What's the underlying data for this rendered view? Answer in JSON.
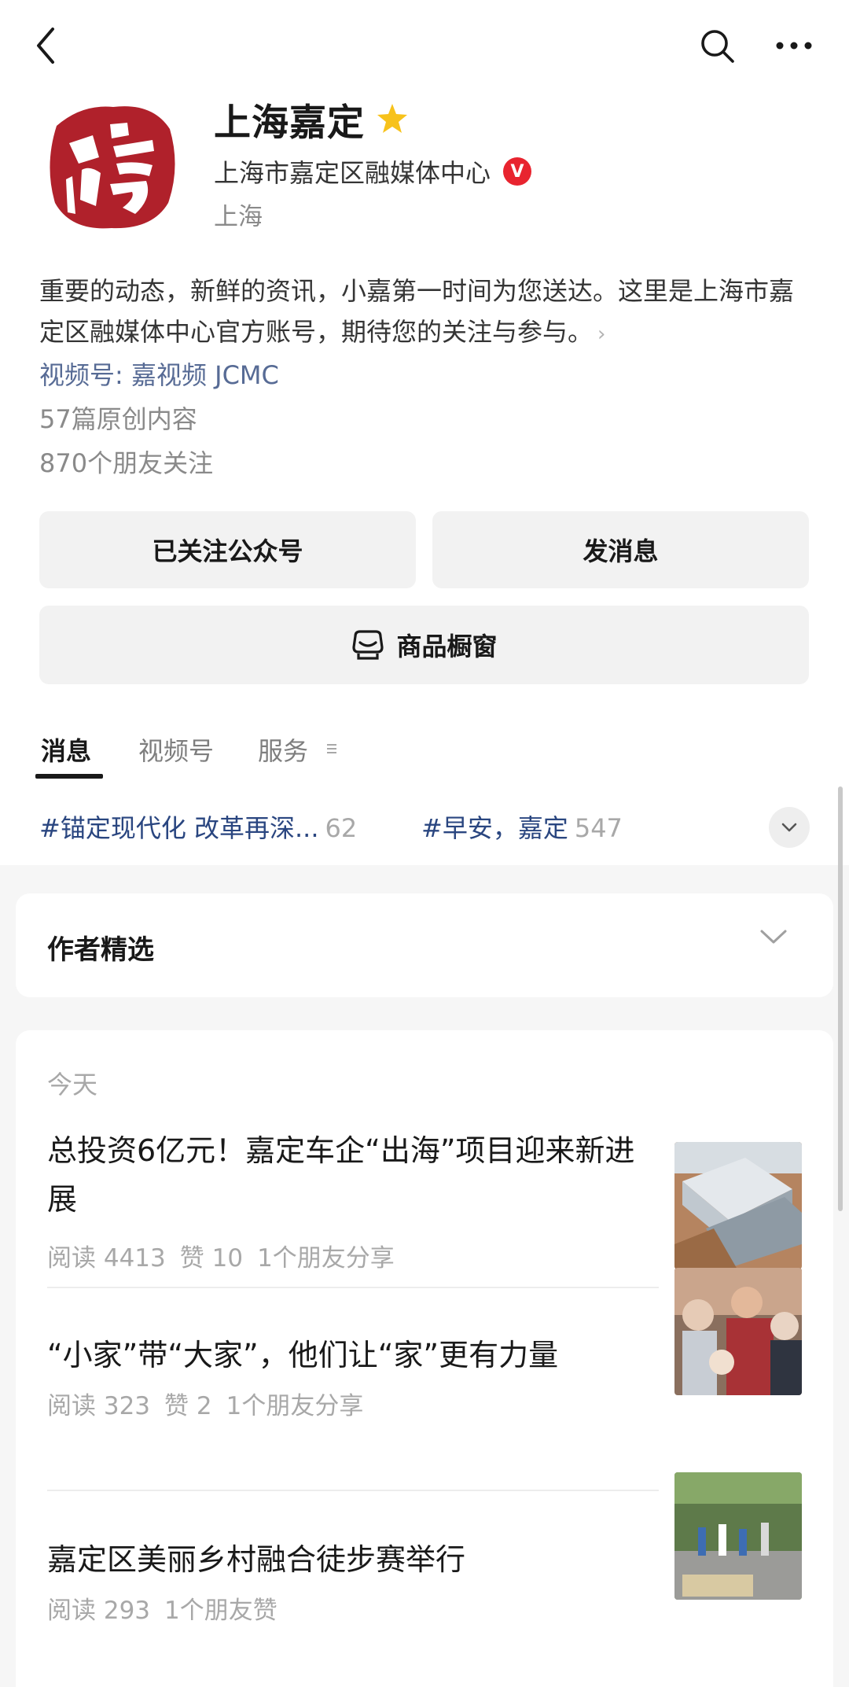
{
  "header": {
    "back_icon": "chevron-left-icon",
    "search_icon": "search-icon",
    "more_icon": "more-dots-icon"
  },
  "profile": {
    "name": "上海嘉定",
    "star_color": "#f7c21b",
    "organization": "上海市嘉定区融媒体中心",
    "verified_badge": "V",
    "verified_color": "#e8242f",
    "region": "上海",
    "description": "重要的动态，新鲜的资讯，小嘉第一时间为您送达。这里是上海市嘉定区融媒体中心官方账号，期待您的关注与参与。",
    "channel": "视频号: 嘉视频 JCMC",
    "original_count": "57篇原创内容",
    "friends_following": "870个朋友关注"
  },
  "actions": {
    "follow_label": "已关注公众号",
    "message_label": "发消息",
    "shop_label": "商品橱窗"
  },
  "tabs": [
    {
      "label": "消息",
      "active": true
    },
    {
      "label": "视频号",
      "active": false
    },
    {
      "label": "服务",
      "active": false
    }
  ],
  "topics": [
    {
      "label": "#锚定现代化 改革再深...",
      "count": "62"
    },
    {
      "label": "#早安，嘉定",
      "count": "547"
    }
  ],
  "author_picks": {
    "title": "作者精选"
  },
  "feed": {
    "day_label": "今天",
    "articles": [
      {
        "title": "总投资6亿元！嘉定车企“出海”项目迎来新进展",
        "meta": [
          "阅读 4413",
          "赞 10",
          "1个朋友分享"
        ]
      },
      {
        "title": "“小家”带“大家”，他们让“家”更有力量",
        "meta": [
          "阅读 323",
          "赞 2",
          "1个朋友分享"
        ]
      },
      {
        "title": "嘉定区美丽乡村融合徒步赛举行",
        "meta": [
          "阅读 293",
          "1个朋友赞"
        ]
      }
    ]
  },
  "colors": {
    "link": "#576b95",
    "topic": "#2a4680",
    "seal_red": "#b0212b"
  }
}
